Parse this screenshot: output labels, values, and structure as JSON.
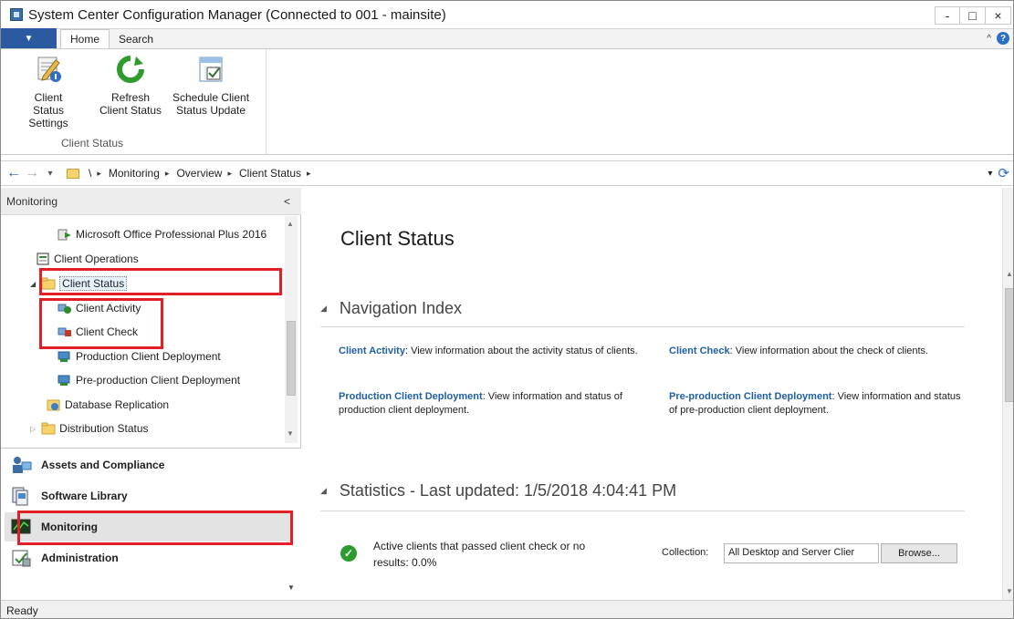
{
  "window": {
    "title": "System Center Configuration Manager (Connected to 001 - mainsite)",
    "controls": [
      "-",
      "□",
      "×"
    ]
  },
  "ribbon": {
    "file_tab_glyph": "▼",
    "tabs": [
      {
        "label": "Home",
        "active": true
      },
      {
        "label": "Search",
        "active": false
      }
    ],
    "help_glyph": "?",
    "collapse_glyph": "^",
    "buttons": [
      {
        "label_line1": "Client Status",
        "label_line2": "Settings",
        "icon": "settings-pencil-icon"
      },
      {
        "label_line1": "Refresh",
        "label_line2": "Client Status",
        "icon": "refresh-icon"
      },
      {
        "label_line1": "Schedule Client",
        "label_line2": "Status Update",
        "icon": "calendar-check-icon"
      }
    ],
    "group_label": "Client Status"
  },
  "addressbar": {
    "back_glyph": "←",
    "forward_glyph": "→",
    "dropdown_glyph": "▾",
    "root": "\\",
    "crumbs": [
      "Monitoring",
      "Overview",
      "Client Status"
    ],
    "sep_glyph": "▸",
    "refresh_glyph": "⟳"
  },
  "leftpane": {
    "header": "Monitoring",
    "collapse_glyph": "<",
    "tree": [
      {
        "label": "Microsoft Office Professional Plus 2016",
        "icon": "deployment-icon"
      },
      {
        "label": "Client Operations",
        "icon": "client-operations-icon"
      },
      {
        "label": "Client Status",
        "icon": "folder-icon",
        "expanded": true,
        "selected": true
      },
      {
        "label": "Client Activity",
        "icon": "client-activity-icon"
      },
      {
        "label": "Client Check",
        "icon": "client-check-icon"
      },
      {
        "label": "Production Client Deployment",
        "icon": "client-deployment-icon"
      },
      {
        "label": "Pre-production Client Deployment",
        "icon": "client-deployment-icon"
      },
      {
        "label": "Database Replication",
        "icon": "database-replication-icon"
      },
      {
        "label": "Distribution Status",
        "icon": "folder-icon",
        "expanded": false
      }
    ],
    "workspaces": [
      {
        "label": "Assets and Compliance",
        "icon": "assets-compliance-icon"
      },
      {
        "label": "Software Library",
        "icon": "software-library-icon"
      },
      {
        "label": "Monitoring",
        "icon": "monitoring-icon",
        "selected": true
      },
      {
        "label": "Administration",
        "icon": "administration-icon"
      }
    ]
  },
  "content": {
    "title": "Client Status",
    "nav_section": "Navigation Index",
    "nav_items": [
      {
        "link": "Client Activity",
        "text": ": View information about the activity status of clients."
      },
      {
        "link": "Client Check",
        "text": ": View information about the check of clients."
      },
      {
        "link": "Production Client Deployment",
        "text": ": View information and status of production client deployment."
      },
      {
        "link": "Pre-production Client Deployment",
        "text": ": View information and status of pre-production client deployment."
      }
    ],
    "stats_section": "Statistics - Last updated: 1/5/2018 4:04:41 PM",
    "stat_line1": "Active clients that passed client check or no",
    "stat_line2": "results: 0.0%",
    "collection_label": "Collection:",
    "collection_value": "All Desktop and Server Clier",
    "browse_label": "Browse...",
    "collapse_glyph": "◢"
  },
  "statusbar": {
    "text": "Ready"
  },
  "colors": {
    "accent": "#2c5aa0",
    "link": "#1f5fa8",
    "highlight_box": "#e21f26",
    "success": "#2e9b2e"
  }
}
